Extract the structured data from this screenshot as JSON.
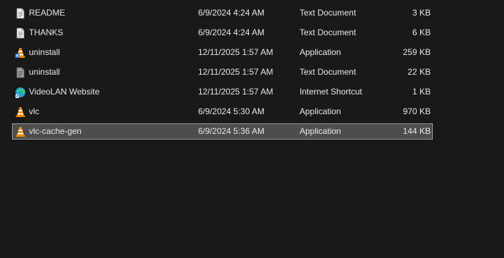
{
  "files": [
    {
      "name": "README",
      "date": "6/9/2024 4:24 AM",
      "type": "Text Document",
      "size": "3 KB",
      "icon": "text-document-icon",
      "selected": false
    },
    {
      "name": "THANKS",
      "date": "6/9/2024 4:24 AM",
      "type": "Text Document",
      "size": "6 KB",
      "icon": "text-document-icon",
      "selected": false
    },
    {
      "name": "uninstall",
      "date": "12/11/2025 1:57 AM",
      "type": "Application",
      "size": "259 KB",
      "icon": "uninstaller-app-icon",
      "selected": false
    },
    {
      "name": "uninstall",
      "date": "12/11/2025 1:57 AM",
      "type": "Text Document",
      "size": "22 KB",
      "icon": "text-document-dark-icon",
      "selected": false
    },
    {
      "name": "VideoLAN Website",
      "date": "12/11/2025 1:57 AM",
      "type": "Internet Shortcut",
      "size": "1 KB",
      "icon": "edge-shortcut-icon",
      "selected": false
    },
    {
      "name": "vlc",
      "date": "6/9/2024 5:30 AM",
      "type": "Application",
      "size": "970 KB",
      "icon": "vlc-cone-icon",
      "selected": false
    },
    {
      "name": "vlc-cache-gen",
      "date": "6/9/2024 5:36 AM",
      "type": "Application",
      "size": "144 KB",
      "icon": "vlc-cone-icon",
      "selected": true
    }
  ],
  "colors": {
    "background": "#191919",
    "text": "#e8e8e8",
    "selected_background": "#4d4d4d",
    "selected_border": "#9a9a9a",
    "vlc_orange": "#f08a00"
  }
}
